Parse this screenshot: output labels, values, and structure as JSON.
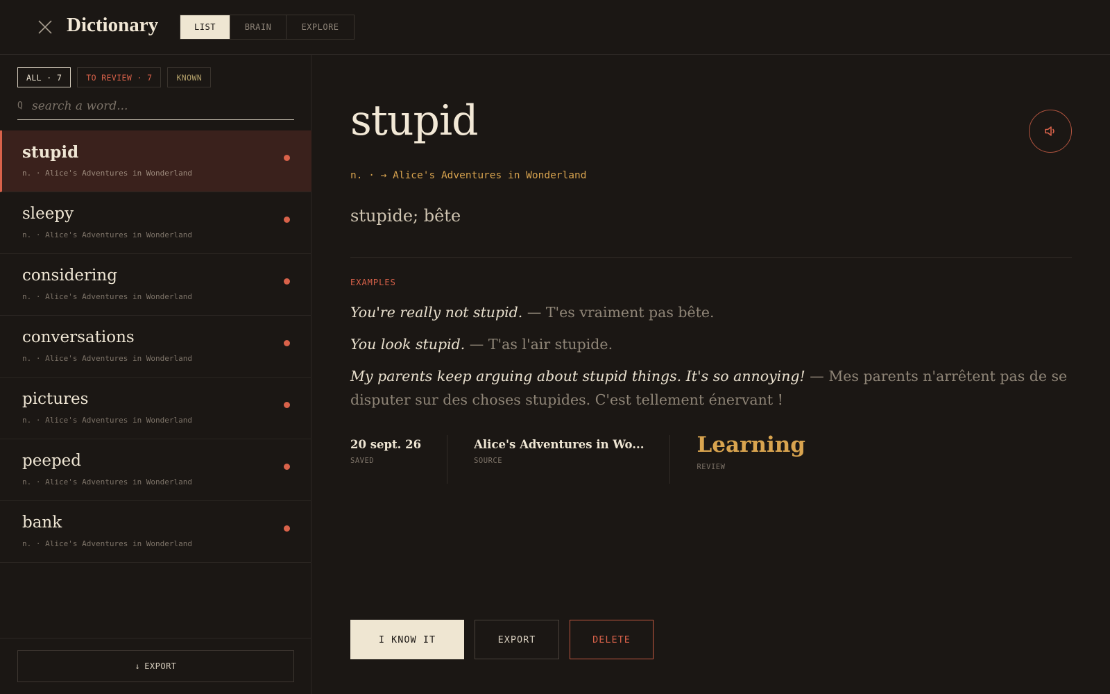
{
  "header": {
    "title": "Dictionary",
    "tabs": [
      {
        "label": "LIST",
        "active": true
      },
      {
        "label": "BRAIN",
        "active": false
      },
      {
        "label": "EXPLORE",
        "active": false
      }
    ]
  },
  "sidebar": {
    "filters": {
      "all": "ALL · 7",
      "to_review": "TO REVIEW · 7",
      "known": "KNOWN"
    },
    "search": {
      "icon_glyph": "Q",
      "placeholder": "search a word...",
      "value": ""
    },
    "words": [
      {
        "word": "stupid",
        "meta": "n. · Alice's Adventures in Wonderland",
        "active": true,
        "status": "to-review"
      },
      {
        "word": "sleepy",
        "meta": "n. · Alice's Adventures in Wonderland",
        "active": false,
        "status": "to-review"
      },
      {
        "word": "considering",
        "meta": "n. · Alice's Adventures in Wonderland",
        "active": false,
        "status": "to-review"
      },
      {
        "word": "conversations",
        "meta": "n. · Alice's Adventures in Wonderland",
        "active": false,
        "status": "to-review"
      },
      {
        "word": "pictures",
        "meta": "n. · Alice's Adventures in Wonderland",
        "active": false,
        "status": "to-review"
      },
      {
        "word": "peeped",
        "meta": "n. · Alice's Adventures in Wonderland",
        "active": false,
        "status": "to-review"
      },
      {
        "word": "bank",
        "meta": "n. · Alice's Adventures in Wonderland",
        "active": false,
        "status": "to-review"
      }
    ],
    "export_label": "EXPORT",
    "export_icon": "↓"
  },
  "detail": {
    "headword": "stupid",
    "pos_line": "n. · → Alice's Adventures in Wonderland",
    "translation": "stupide; bête",
    "examples_label": "EXAMPLES",
    "examples": [
      {
        "en": "You're really not stupid.",
        "fr": " — T'es vraiment pas bête."
      },
      {
        "en": "You look stupid.",
        "fr": " — T'as l'air stupide."
      },
      {
        "en": "My parents keep arguing about stupid things. It's so annoying!",
        "fr": " — Mes parents n'arrêtent pas de se disputer sur des choses stupides. C'est tellement énervant !"
      }
    ],
    "stats": {
      "saved_value": "20 sept. 26",
      "saved_label": "SAVED",
      "source_value": "Alice's Adventures in Wo...",
      "source_label": "SOURCE",
      "review_value": "Learning",
      "review_label": "REVIEW"
    },
    "actions": {
      "know": "I KNOW IT",
      "export": "EXPORT",
      "delete": "DELETE"
    }
  },
  "colors": {
    "background": "#1b1714",
    "accent_red": "#d9624a",
    "accent_gold": "#d9a44f",
    "cream": "#efe6d2"
  }
}
